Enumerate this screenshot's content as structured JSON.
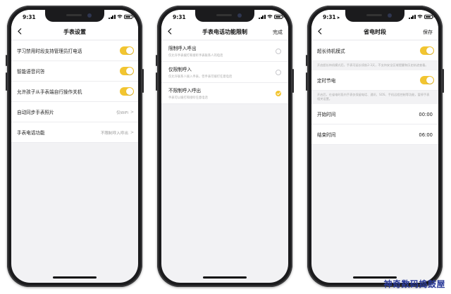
{
  "screens": [
    {
      "status": {
        "time": "9:31",
        "location_arrow": false
      },
      "nav": {
        "title": "手表设置",
        "action": ""
      },
      "rows": [
        {
          "label": "学习禁用时段支持管理员打电话",
          "toggle": true
        },
        {
          "label": "智能语音问答",
          "toggle": true
        },
        {
          "label": "允许孩子从手表端自行操作关机",
          "toggle": true
        },
        {
          "label": "自动同步手表照片",
          "value": "仅WiFi",
          "chevron": ">"
        },
        {
          "label": "手表电话功能",
          "value": "不限制呼入呼出",
          "chevron": ">"
        }
      ]
    },
    {
      "status": {
        "time": "9:31",
        "location_arrow": false
      },
      "nav": {
        "title": "手表电话功能限制",
        "action": "完成"
      },
      "options": [
        {
          "label": "限制呼入呼出",
          "desc": "仅允许手表拨打和接听手表联系人的电话",
          "selected": false
        },
        {
          "label": "仅限制呼入",
          "desc": "仅允许联系人拨入手表，但手表可拨打任意电话",
          "selected": false
        },
        {
          "label": "不限制呼入呼出",
          "desc": "手表可以拨打和接听任意电话",
          "selected": true
        }
      ]
    },
    {
      "status": {
        "time": "9:31",
        "location_arrow": true
      },
      "nav": {
        "title": "省电时段",
        "action": "保存"
      },
      "rows": [
        {
          "label": "超长待机模式",
          "toggle": true,
          "note": "开启超长待机模式后，手表可延长续航2-3天，不支持安全区域提醒和历史轨迹查看。"
        },
        {
          "label": "定时节电",
          "toggle": true,
          "note": "开启后，在省电时段内手表仅保留电话、通讯、SOS、手机远程控制等功能，暂停手表相关设置。"
        },
        {
          "label": "开始时间",
          "time": "00:00"
        },
        {
          "label": "结束时间",
          "time": "06:00"
        }
      ]
    }
  ],
  "icons": {
    "back": "chevron-left-icon",
    "signal": "cellular-signal-icon",
    "wifi": "wifi-icon",
    "battery": "battery-icon"
  },
  "colors": {
    "accent": "#f2c530",
    "screen_bg": "#f2f2f4",
    "phone_frame": "#1b1b1d",
    "watermark": "#2a3a99"
  },
  "watermark": "神奇数码捣鼓屋"
}
